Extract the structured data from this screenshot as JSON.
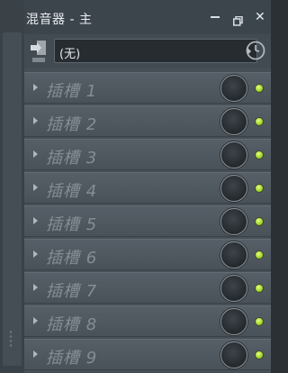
{
  "window": {
    "title": "混音器 - 主",
    "close_glyph": "✕"
  },
  "toolbar": {
    "preset_value": "(无)",
    "eq_icon": "eq-plug-icon",
    "history_icon": "clock-icon"
  },
  "slots": [
    {
      "label": "插槽 1"
    },
    {
      "label": "插槽 2"
    },
    {
      "label": "插槽 3"
    },
    {
      "label": "插槽 4"
    },
    {
      "label": "插槽 5"
    },
    {
      "label": "插槽 6"
    },
    {
      "label": "插槽 7"
    },
    {
      "label": "插槽 8"
    },
    {
      "label": "插槽 9"
    }
  ],
  "colors": {
    "led_on": "#9fd329",
    "panel_bg": "#474f56"
  }
}
